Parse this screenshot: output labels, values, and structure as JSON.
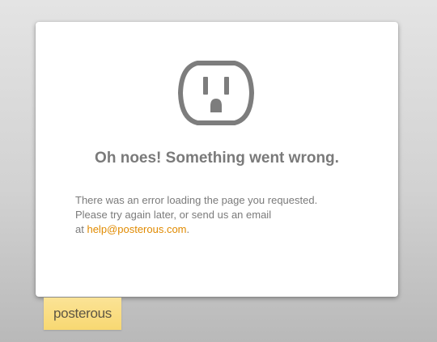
{
  "error": {
    "icon": "power-outlet-icon",
    "title": "Oh noes! Something went wrong.",
    "line1": "There was an error loading the page you requested.",
    "line2": "Please try again later, or send us an email",
    "line3_prefix": "at ",
    "email": "help@posterous.com",
    "line3_suffix": "."
  },
  "brand": {
    "name": "posterous"
  },
  "colors": {
    "accent": "#e08a00",
    "text": "#7b7b7b",
    "brand_tab": "#f8d872"
  }
}
